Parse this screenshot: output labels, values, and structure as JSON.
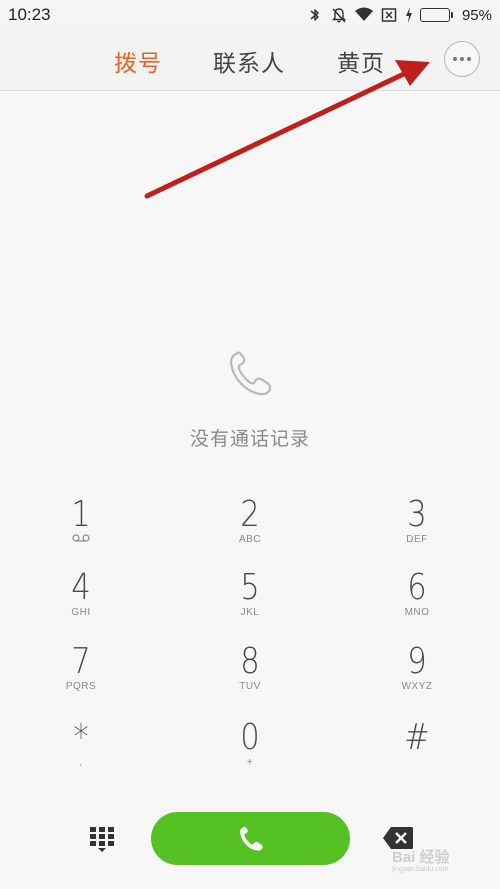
{
  "status_bar": {
    "time": "10:23",
    "battery_percent": "95%",
    "battery_level": 0.95,
    "icons": [
      "bluetooth-icon",
      "mute-bell-icon",
      "wifi-icon",
      "no-sim-icon",
      "charging-icon",
      "battery-icon"
    ]
  },
  "tabs": [
    {
      "label": "拨号",
      "active": true
    },
    {
      "label": "联系人",
      "active": false
    },
    {
      "label": "黄页",
      "active": false
    }
  ],
  "more_button": {
    "icon": "more-dots-icon"
  },
  "empty_state": {
    "icon": "phone-handset-icon",
    "text": "没有通话记录"
  },
  "keypad": {
    "keys": [
      {
        "digit": "1",
        "letters": "QO"
      },
      {
        "digit": "2",
        "letters": "ABC"
      },
      {
        "digit": "3",
        "letters": "DEF"
      },
      {
        "digit": "4",
        "letters": "GHI"
      },
      {
        "digit": "5",
        "letters": "JKL"
      },
      {
        "digit": "6",
        "letters": "MNO"
      },
      {
        "digit": "7",
        "letters": "PQRS"
      },
      {
        "digit": "8",
        "letters": "TUV"
      },
      {
        "digit": "9",
        "letters": "WXYZ"
      },
      {
        "digit": "*",
        "letters": ","
      },
      {
        "digit": "0",
        "letters": "+"
      },
      {
        "digit": "#",
        "letters": ""
      }
    ]
  },
  "bottom_bar": {
    "keypad_toggle_icon": "dialpad-icon",
    "call_icon": "call-icon",
    "backspace_icon": "backspace-icon"
  },
  "colors": {
    "accent": "#f0621e",
    "call_green": "#55c122",
    "annotation_red": "#c0201a"
  },
  "watermark": {
    "text": "Bai 经验",
    "sub": "jingyan.baidu.com"
  }
}
